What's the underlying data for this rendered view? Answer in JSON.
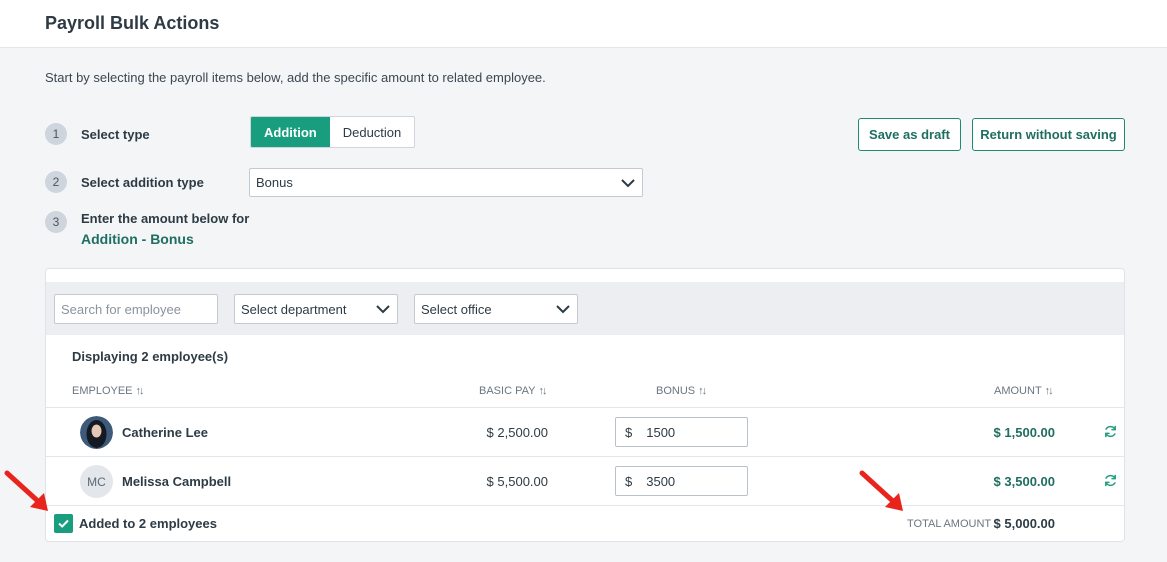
{
  "header": {
    "title": "Payroll Bulk Actions"
  },
  "intro": "Start by selecting the payroll items below, add the specific amount to related employee.",
  "steps": [
    {
      "num": "1",
      "label": "Select type"
    },
    {
      "num": "2",
      "label": "Select addition type"
    },
    {
      "num": "3",
      "label": "Enter the amount below for",
      "sub": "Addition - Bonus"
    }
  ],
  "type_toggle": {
    "options": [
      "Addition",
      "Deduction"
    ],
    "selected": "Addition"
  },
  "addition_type": {
    "value": "Bonus"
  },
  "actions": {
    "save_draft": "Save as draft",
    "return": "Return without saving"
  },
  "filters": {
    "search_placeholder": "Search for employee",
    "department": "Select department",
    "office": "Select office"
  },
  "displaying": "Displaying 2 employee(s)",
  "columns": {
    "employee": "EMPLOYEE",
    "basic_pay": "BASIC PAY",
    "bonus": "BONUS",
    "amount": "AMOUNT"
  },
  "employees": [
    {
      "name": "Catherine Lee",
      "initials": "",
      "basic_pay": "$ 2,500.00",
      "currency": "$",
      "bonus": "1500",
      "amount": "$ 1,500.00"
    },
    {
      "name": "Melissa Campbell",
      "initials": "MC",
      "basic_pay": "$ 5,500.00",
      "currency": "$",
      "bonus": "3500",
      "amount": "$ 3,500.00"
    }
  ],
  "footer": {
    "added_label": "Added to 2 employees",
    "added_checked": true,
    "total_label": "TOTAL AMOUNT",
    "total_value": "$ 5,000.00"
  },
  "colors": {
    "accent": "#189e7f",
    "accent_text": "#1f6e61",
    "annotation_arrow": "#e8241c"
  },
  "icons": {
    "refresh": "refresh-icon",
    "chevron": "chevron-down-icon",
    "sort": "sort-icon",
    "check": "check-icon"
  }
}
